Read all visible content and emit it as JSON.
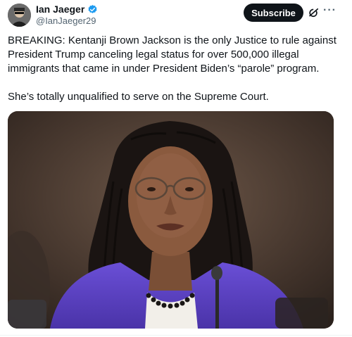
{
  "author": {
    "display_name": "Ian Jaeger",
    "handle": "@IanJaeger29",
    "verified_color": "#1d9bf0",
    "avatar_icon": "avatar-icon"
  },
  "actions": {
    "subscribe_label": "Subscribe",
    "grok_icon": "grok-icon",
    "more_icon": "more-icon"
  },
  "tweet": {
    "paragraph_1": "BREAKING: Kentanji Brown Jackson is the only Justice to rule against President Trump canceling legal status for over 500,000 illegal immigrants that came in under President Biden’s “parole” program.",
    "paragraph_2": "She’s totally unqualified to serve on the Supreme Court."
  },
  "colors": {
    "text": "#0f1419",
    "secondary_text": "#536471",
    "subscribe_bg": "#0f1419",
    "jacket_purple": "#5a3fc0"
  }
}
